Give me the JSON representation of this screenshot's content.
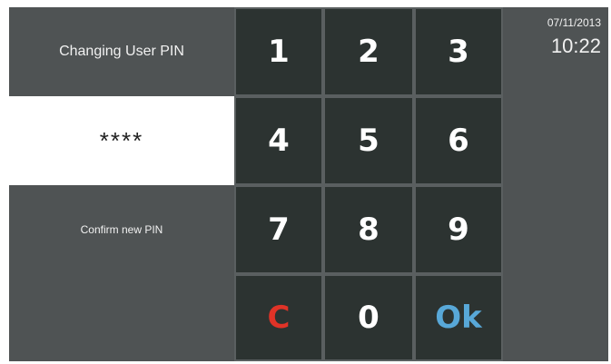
{
  "header": {
    "title": "Changing User PIN"
  },
  "pin": {
    "masked_value": "****"
  },
  "status": {
    "message": "Confirm new PIN"
  },
  "clock": {
    "date": "07/11/2013",
    "time": "10:22"
  },
  "keypad": {
    "keys": [
      "1",
      "2",
      "3",
      "4",
      "5",
      "6",
      "7",
      "8",
      "9",
      "C",
      "0",
      "Ok"
    ]
  },
  "colors": {
    "background": "#4f5354",
    "key": "#2c3331",
    "clear": "#e03327",
    "ok": "#58a8d8"
  }
}
